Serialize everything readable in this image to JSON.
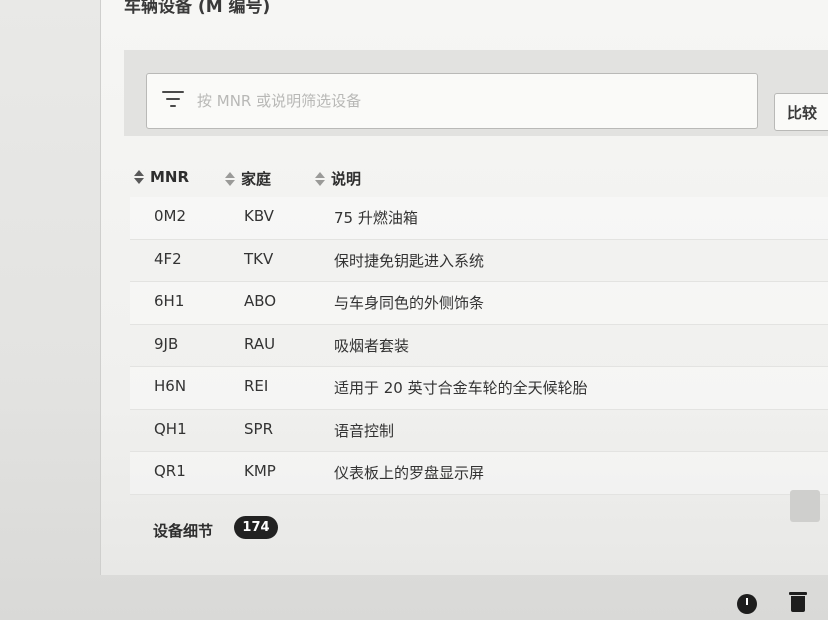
{
  "header": {
    "title": "车辆设备 (M 编号)"
  },
  "filter": {
    "placeholder": "按 MNR 或说明筛选设备",
    "value": "",
    "compare_label": "比较"
  },
  "columns": {
    "mnr": "MNR",
    "family": "家庭",
    "description": "说明"
  },
  "rows": [
    {
      "mnr": "0M2",
      "family": "KBV",
      "description": "75 升燃油箱"
    },
    {
      "mnr": "4F2",
      "family": "TKV",
      "description": "保时捷免钥匙进入系统"
    },
    {
      "mnr": "6H1",
      "family": "ABO",
      "description": "与车身同色的外侧饰条"
    },
    {
      "mnr": "9JB",
      "family": "RAU",
      "description": "吸烟者套装"
    },
    {
      "mnr": "H6N",
      "family": "REI",
      "description": "适用于 20 英寸合金车轮的全天候轮胎"
    },
    {
      "mnr": "QH1",
      "family": "SPR",
      "description": "语音控制"
    },
    {
      "mnr": "QR1",
      "family": "KMP",
      "description": "仪表板上的罗盘显示屏"
    }
  ],
  "footer": {
    "details_label": "设备细节",
    "count": "174"
  },
  "icons": {
    "filter": "filter-icon",
    "sort": "sort-icon",
    "clock": "clock-icon",
    "trash": "trash-icon"
  }
}
